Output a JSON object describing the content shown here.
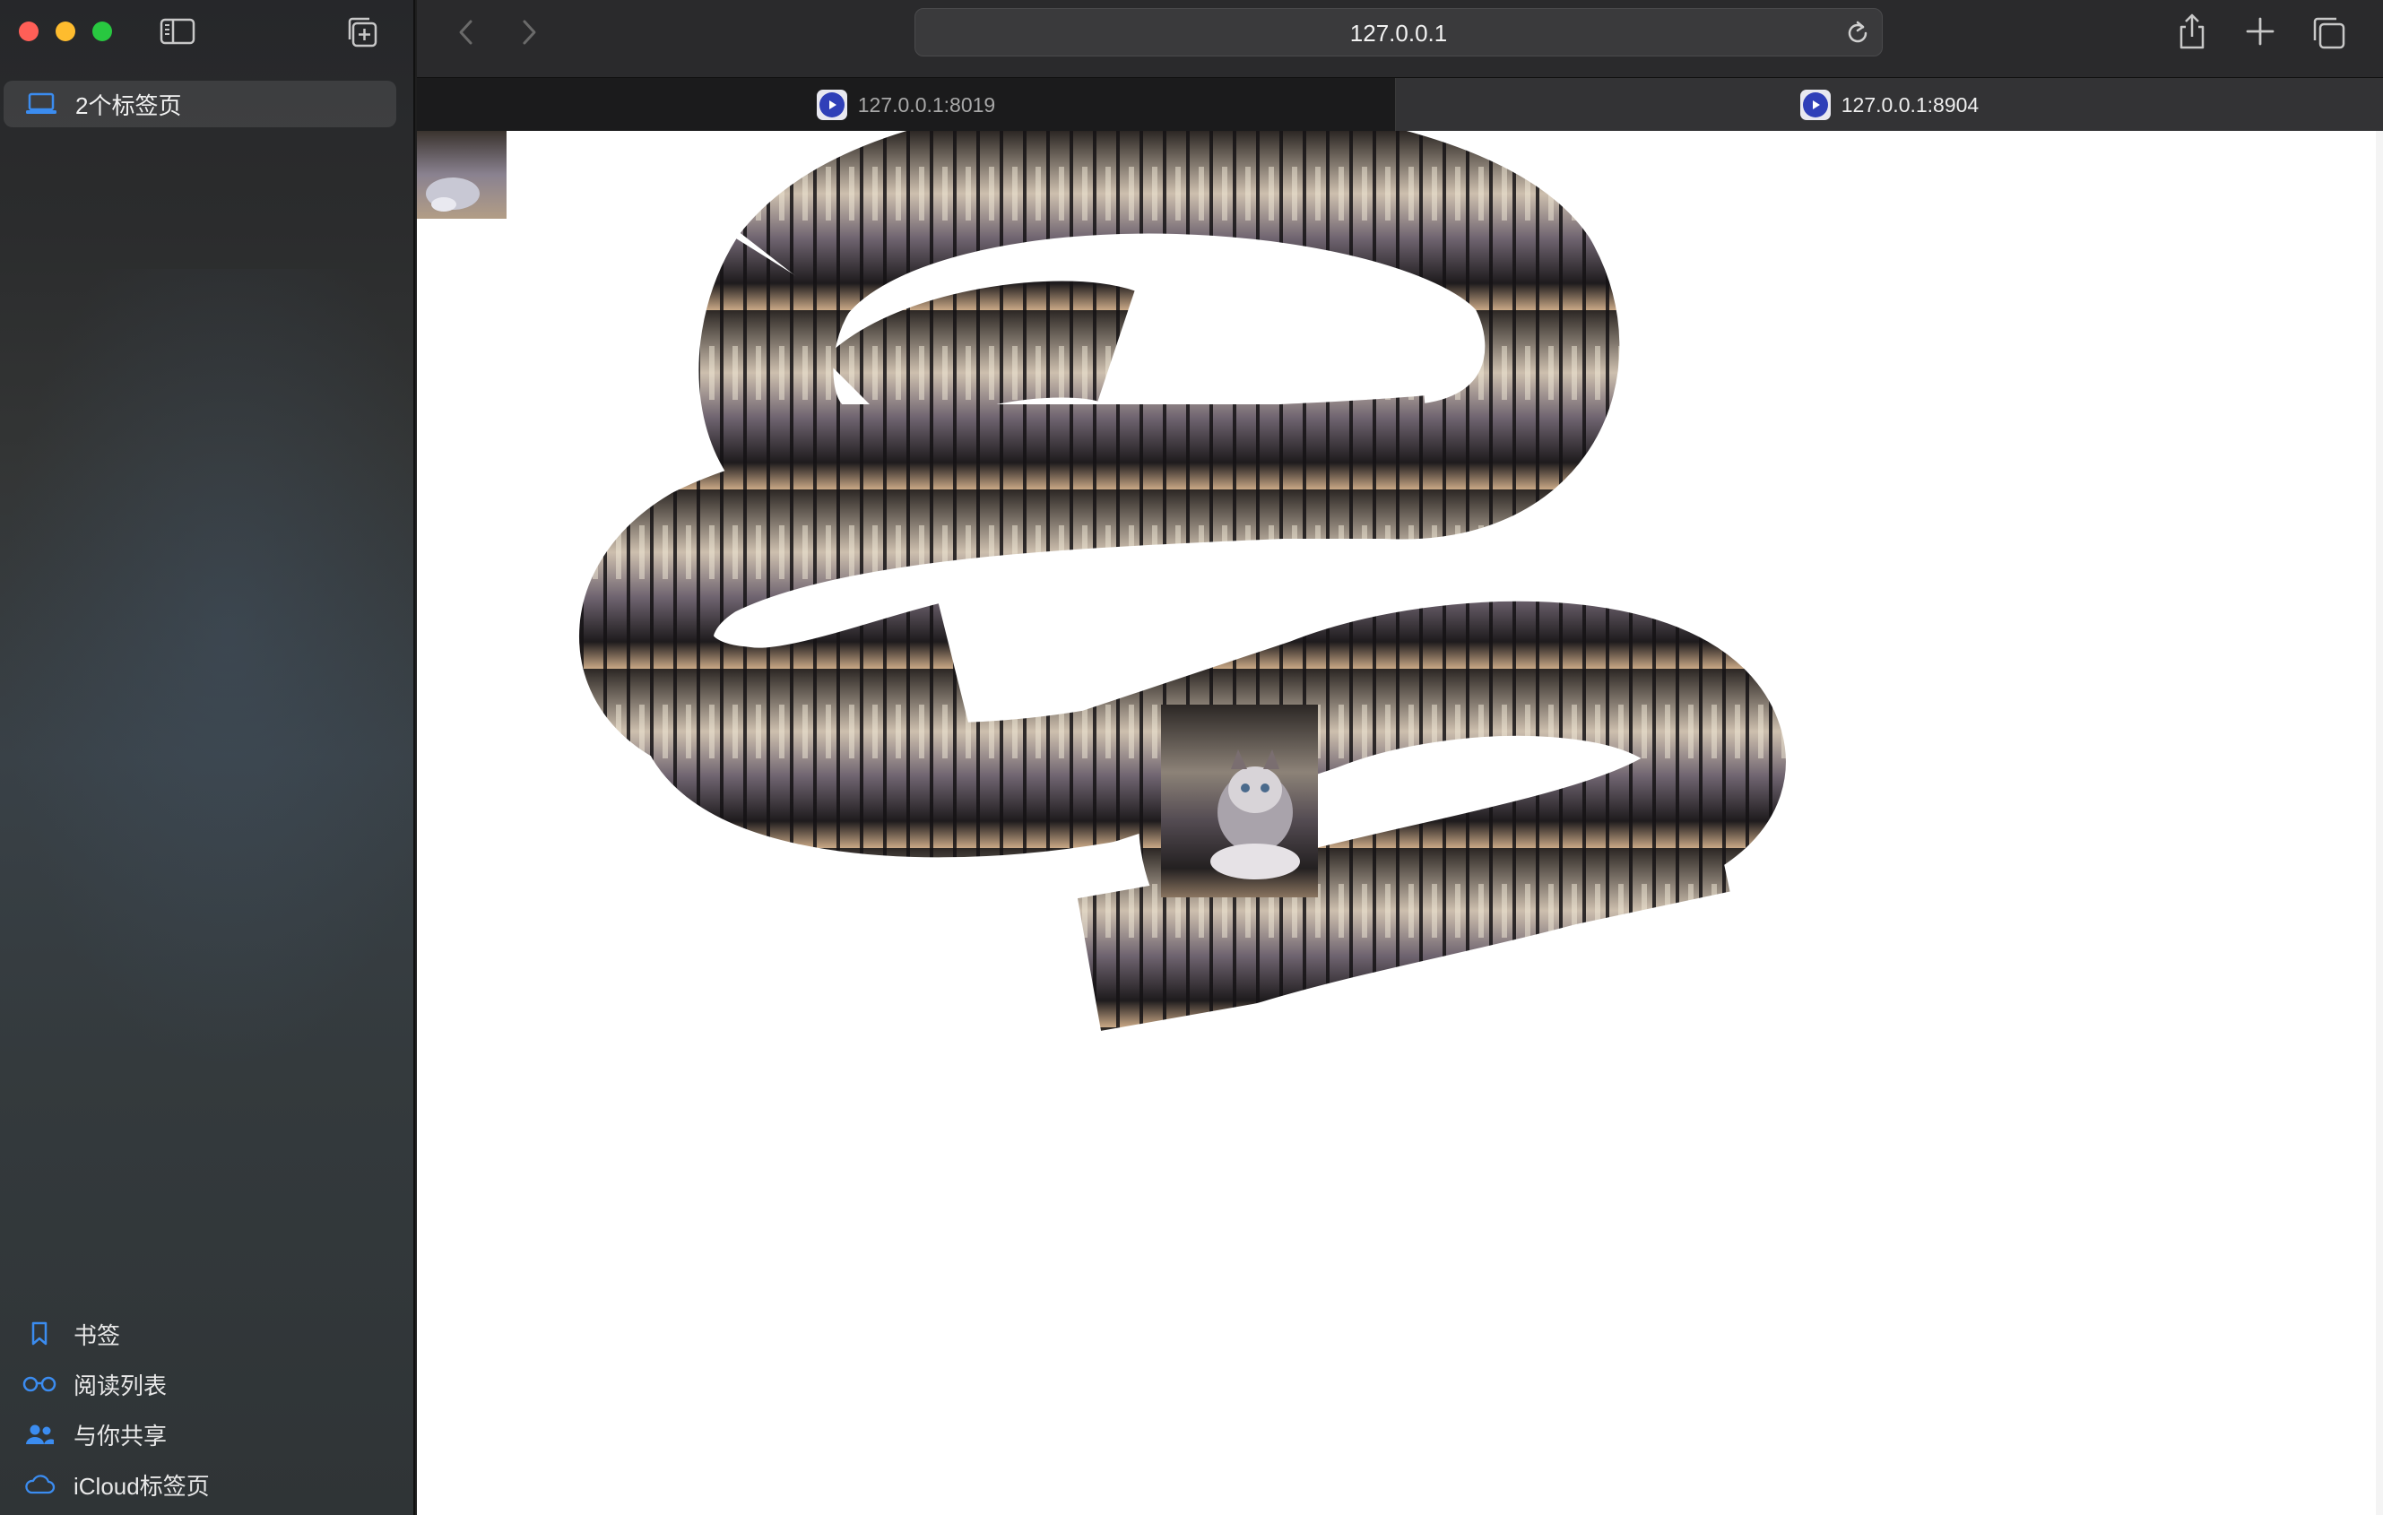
{
  "window": {
    "traffic_lights": [
      "close",
      "minimize",
      "zoom"
    ]
  },
  "sidebar": {
    "tab_group_label": "2个标签页",
    "footer_items": [
      {
        "label": "书签",
        "icon": "bookmark-icon"
      },
      {
        "label": "阅读列表",
        "icon": "reading-list-icon"
      },
      {
        "label": "与你共享",
        "icon": "shared-with-you-icon"
      },
      {
        "label": "iCloud标签页",
        "icon": "icloud-icon"
      }
    ]
  },
  "toolbar": {
    "address": "127.0.0.1"
  },
  "tabs": [
    {
      "label": "127.0.0.1:8019",
      "active": false
    },
    {
      "label": "127.0.0.1:8904",
      "active": true
    }
  ],
  "colors": {
    "accent": "#2f7df6",
    "favicon": "#2f3fb8"
  }
}
